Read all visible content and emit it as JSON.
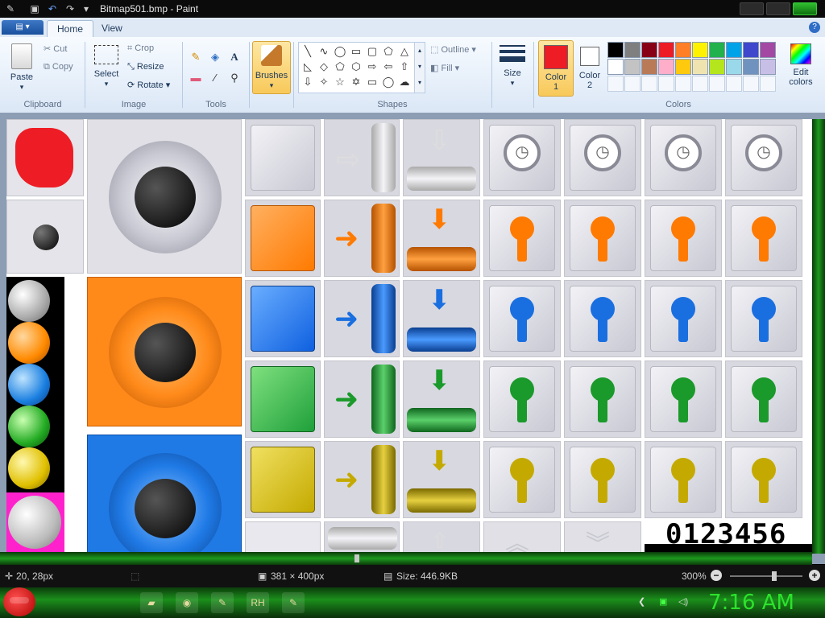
{
  "window": {
    "title": "Bitmap501.bmp - Paint"
  },
  "quick_access": {
    "save_icon": "save-icon",
    "undo_icon": "undo-icon",
    "redo_icon": "redo-icon",
    "dropdown_icon": "chevron-down-icon"
  },
  "tabs": [
    {
      "label": "Home",
      "active": true
    },
    {
      "label": "View",
      "active": false
    }
  ],
  "ribbon": {
    "clipboard": {
      "paste": "Paste",
      "cut": "Cut",
      "copy": "Copy",
      "group_label": "Clipboard"
    },
    "image": {
      "select": "Select",
      "crop": "Crop",
      "resize": "Resize",
      "rotate": "Rotate",
      "group_label": "Image"
    },
    "tools": {
      "group_label": "Tools"
    },
    "brushes": "Brushes",
    "shapes": {
      "outline": "Outline",
      "fill": "Fill",
      "group_label": "Shapes"
    },
    "size": "Size",
    "color1": {
      "label": "Color",
      "num": "1",
      "value": "#ee1c24"
    },
    "color2": {
      "label": "Color",
      "num": "2",
      "value": "#ffffff"
    },
    "colors": {
      "group_label": "Colors",
      "palette": [
        "#000000",
        "#7f7f7f",
        "#880015",
        "#ed1c24",
        "#ff7f27",
        "#fff200",
        "#22b14c",
        "#00a2e8",
        "#3f48cc",
        "#a349a4",
        "#ffffff",
        "#c3c3c3",
        "#b97a57",
        "#ffaec9",
        "#ffc90e",
        "#efe4b0",
        "#b5e61d",
        "#99d9ea",
        "#7092be",
        "#c8bfe7"
      ],
      "edit": "Edit colors"
    }
  },
  "canvas": {
    "digits_text": "0123456"
  },
  "status": {
    "cursor_pos": "20, 28px",
    "selection_size": "381 × 400px",
    "file_size": "Size: 446.9KB",
    "zoom": "300%"
  },
  "taskbar": {
    "clock": "7:16 AM",
    "rh_label": "RH"
  },
  "accent": {
    "taskbar_green": "#1b8f1b",
    "clock_green": "#2ce22c"
  }
}
